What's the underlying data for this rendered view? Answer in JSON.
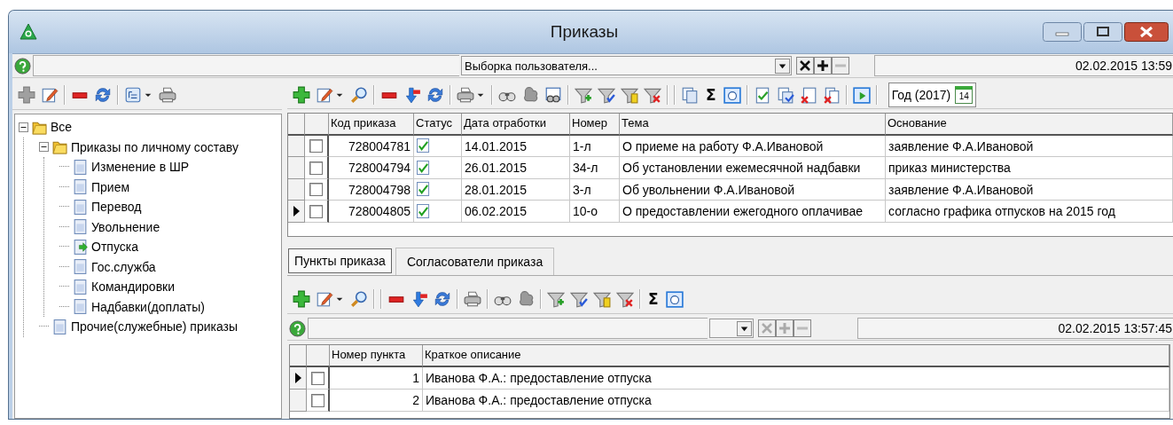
{
  "window": {
    "title": "Приказы"
  },
  "filter_bar": {
    "selection": "Выборка пользователя...",
    "timestamp": "02.02.2015 13:59"
  },
  "tree": [
    {
      "label": "Все",
      "kind": "folder",
      "expanded": true,
      "children": [
        {
          "label": "Приказы по личному составу",
          "kind": "folder",
          "expanded": true,
          "children": [
            {
              "label": "Изменение в ШР",
              "kind": "document"
            },
            {
              "label": "Прием",
              "kind": "document"
            },
            {
              "label": "Перевод",
              "kind": "document"
            },
            {
              "label": "Увольнение",
              "kind": "document"
            },
            {
              "label": "Отпуска",
              "kind": "document-arrow"
            },
            {
              "label": "Гос.служба",
              "kind": "document"
            },
            {
              "label": "Командировки",
              "kind": "document"
            },
            {
              "label": "Надбавки(доплаты)",
              "kind": "document"
            }
          ]
        },
        {
          "label": "Прочие(служебные) приказы",
          "kind": "document"
        }
      ]
    }
  ],
  "main_toolbar": {
    "sum_button": "Σ",
    "period": "Год (2017)",
    "calendar_day": "14"
  },
  "orders_table": {
    "columns": [
      "Код приказа",
      "Статус",
      "Дата отработки",
      "Номер",
      "Тема",
      "Основание"
    ],
    "rows": [
      {
        "selected": false,
        "checked": false,
        "code": "728004781",
        "approved": true,
        "date": "14.01.2015",
        "number": "1-л",
        "subject": "О приеме на работу Ф.А.Ивановой",
        "basis": "заявление Ф.А.Ивановой"
      },
      {
        "selected": false,
        "checked": false,
        "code": "728004794",
        "approved": true,
        "date": "26.01.2015",
        "number": "34-л",
        "subject": "Об установлении ежемесячной надбавки",
        "basis": "приказ министерства"
      },
      {
        "selected": false,
        "checked": false,
        "code": "728004798",
        "approved": true,
        "date": "28.01.2015",
        "number": "3-л",
        "subject": "Об увольнении Ф.А.Ивановой",
        "basis": "заявление Ф.А.Ивановой"
      },
      {
        "selected": true,
        "checked": false,
        "code": "728004805",
        "approved": true,
        "date": "06.02.2015",
        "number": "10-о",
        "subject": "О предоставлении ежегодного оплачивае",
        "basis": "согласно графика отпусков на 2015 год"
      }
    ]
  },
  "tabs": [
    {
      "label": "Пункты приказа",
      "selected": true
    },
    {
      "label": "Согласователи приказа",
      "selected": false
    }
  ],
  "items_toolbar": {
    "sum_button": "Σ"
  },
  "items_filter_bar": {
    "timestamp": "02.02.2015 13:57:45"
  },
  "items_table": {
    "columns": [
      "Номер пункта",
      "Краткое описание"
    ],
    "rows": [
      {
        "selected": true,
        "checked": false,
        "number": "1",
        "description": "Иванова Ф.А.: предоставление отпуска"
      },
      {
        "selected": false,
        "checked": false,
        "number": "2",
        "description": "Иванова Ф.А.: предоставление отпуска"
      }
    ]
  }
}
